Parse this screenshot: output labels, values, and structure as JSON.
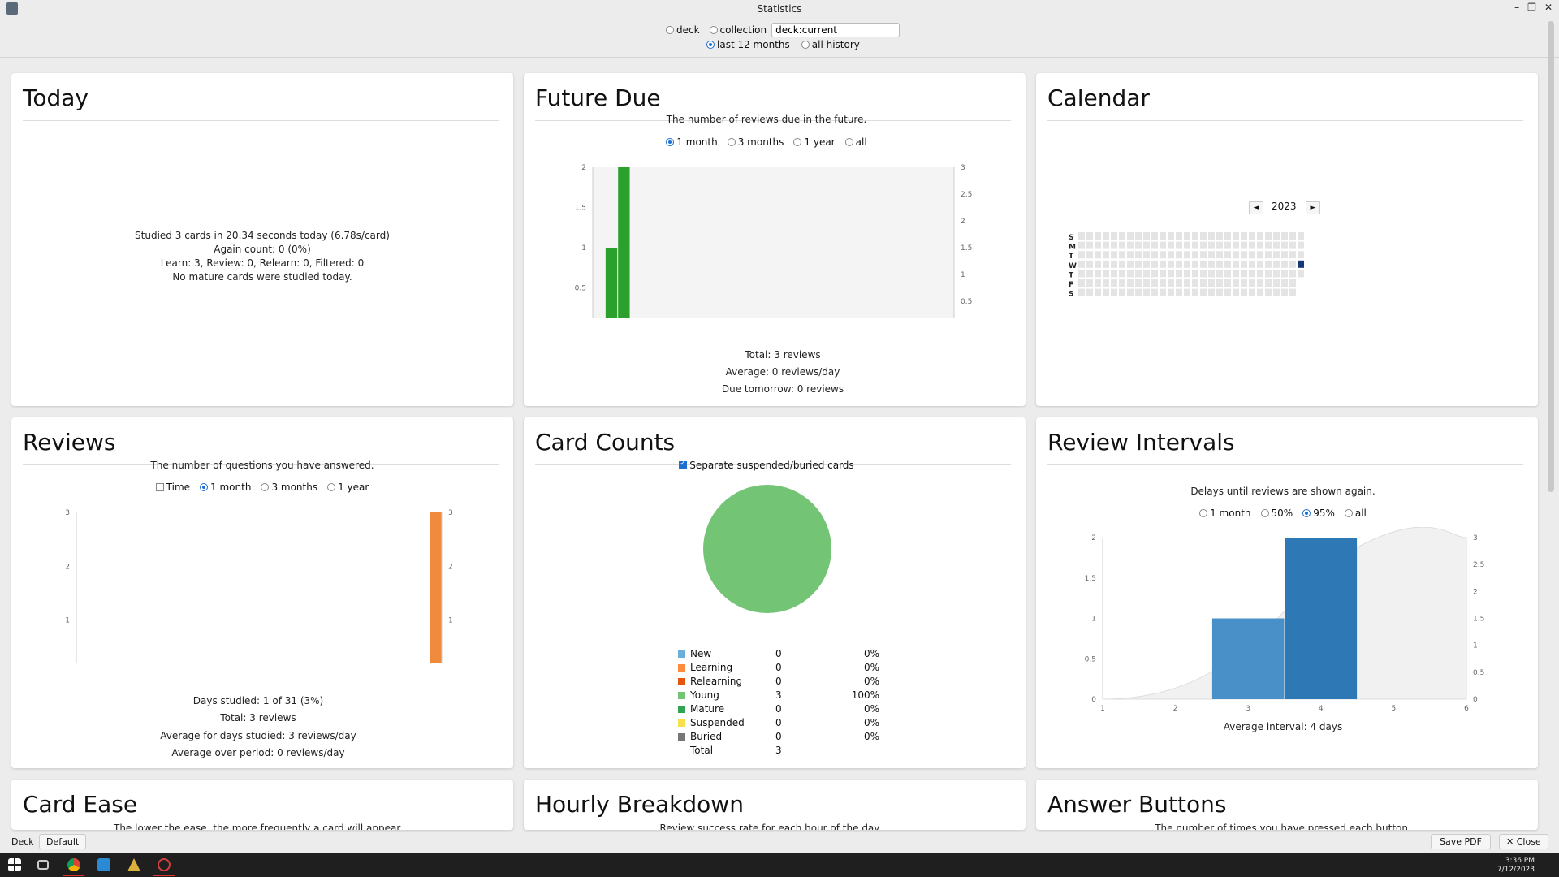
{
  "window": {
    "title": "Statistics",
    "min": "–",
    "max": "❐",
    "close": "✕"
  },
  "controls": {
    "deck_label": "deck",
    "collection_label": "collection",
    "search_value": "deck:current",
    "last12_label": "last 12 months",
    "allhistory_label": "all history"
  },
  "today": {
    "title": "Today",
    "lines": [
      "Studied 3 cards in 20.34 seconds today (6.78s/card)",
      "Again count: 0 (0%)",
      "Learn: 3, Review: 0, Relearn: 0, Filtered: 0",
      "No mature cards were studied today."
    ]
  },
  "future_due": {
    "title": "Future Due",
    "subtitle": "The number of reviews due in the future.",
    "options": [
      "1 month",
      "3 months",
      "1 year",
      "all"
    ],
    "stats": [
      "Total: 3 reviews",
      "Average: 0 reviews/day",
      "Due tomorrow: 0 reviews"
    ]
  },
  "calendar": {
    "title": "Calendar",
    "year": "2023",
    "prev": "◄",
    "next": "►",
    "days": [
      "S",
      "M",
      "T",
      "W",
      "T",
      "F",
      "S"
    ]
  },
  "reviews": {
    "title": "Reviews",
    "subtitle": "The number of questions you have answered.",
    "time_label": "Time",
    "options": [
      "1 month",
      "3 months",
      "1 year"
    ],
    "stats": [
      "Days studied: 1 of 31 (3%)",
      "Total: 3 reviews",
      "Average for days studied: 3 reviews/day",
      "Average over period: 0 reviews/day"
    ]
  },
  "card_counts": {
    "title": "Card Counts",
    "checkbox_label": "Separate suspended/buried cards",
    "rows": [
      {
        "name": "New",
        "count": "0",
        "pct": "0%",
        "color": "#6baed6"
      },
      {
        "name": "Learning",
        "count": "0",
        "pct": "0%",
        "color": "#fd8d3c"
      },
      {
        "name": "Relearning",
        "count": "0",
        "pct": "0%",
        "color": "#e6550d"
      },
      {
        "name": "Young",
        "count": "3",
        "pct": "100%",
        "color": "#74c476"
      },
      {
        "name": "Mature",
        "count": "0",
        "pct": "0%",
        "color": "#31a354"
      },
      {
        "name": "Suspended",
        "count": "0",
        "pct": "0%",
        "color": "#f6e04b"
      },
      {
        "name": "Buried",
        "count": "0",
        "pct": "0%",
        "color": "#777777"
      }
    ],
    "total_label": "Total",
    "total_value": "3"
  },
  "review_intervals": {
    "title": "Review Intervals",
    "subtitle": "Delays until reviews are shown again.",
    "options": [
      "1 month",
      "50%",
      "95%",
      "all"
    ],
    "stats": [
      "Average interval: 4 days"
    ]
  },
  "card_ease": {
    "title": "Card Ease",
    "subtitle": "The lower the ease, the more frequently a card will appear."
  },
  "hourly": {
    "title": "Hourly Breakdown",
    "subtitle": "Review success rate for each hour of the day."
  },
  "answer_buttons": {
    "title": "Answer Buttons",
    "subtitle": "The number of times you have pressed each button."
  },
  "statusbar": {
    "deck_label": "Deck",
    "deck_value": "Default",
    "save_pdf": "Save PDF",
    "close": "✕ Close"
  },
  "taskbar": {
    "time": "3:36 PM",
    "date": "7/12/2023"
  },
  "chart_data": [
    {
      "type": "bar",
      "name": "future-due",
      "x": [
        3,
        4
      ],
      "values": [
        1,
        2
      ],
      "xticks": [
        5,
        10,
        15,
        20,
        25,
        30
      ],
      "xlim": [
        2,
        31
      ],
      "ylim": [
        0,
        2
      ],
      "yticks": [
        "0",
        "0.5",
        "1",
        "1.5",
        "2"
      ],
      "y2ticks": [
        "0",
        "0.5",
        "1",
        "1.5",
        "2",
        "2.5",
        "3"
      ],
      "color": "#2ca02c"
    },
    {
      "type": "bar",
      "name": "reviews",
      "x": [
        0
      ],
      "values": [
        3
      ],
      "xticks": [
        "−30",
        "−25",
        "−20",
        "−15",
        "−10",
        "−5",
        "0"
      ],
      "xlim": [
        -30,
        1
      ],
      "ylim": [
        0,
        3
      ],
      "yticks": [
        "0",
        "1",
        "2",
        "3"
      ],
      "y2ticks": [
        "0",
        "1",
        "2",
        "3"
      ],
      "color": "#f08a3c"
    },
    {
      "type": "pie",
      "name": "card-counts",
      "categories": [
        "Young"
      ],
      "values": [
        3
      ],
      "color": "#74c476"
    },
    {
      "type": "bar",
      "name": "review-intervals",
      "x": [
        3,
        4
      ],
      "values": [
        1,
        2
      ],
      "xticks": [
        "1",
        "2",
        "3",
        "4",
        "5",
        "6"
      ],
      "xlim": [
        1,
        6
      ],
      "ylim": [
        0,
        2
      ],
      "yticks": [
        "0",
        "0.5",
        "1",
        "1.5",
        "2"
      ],
      "y2ticks": [
        "0",
        "0.5",
        "1",
        "1.5",
        "2",
        "2.5",
        "3"
      ],
      "color": "#3a86c4"
    }
  ]
}
